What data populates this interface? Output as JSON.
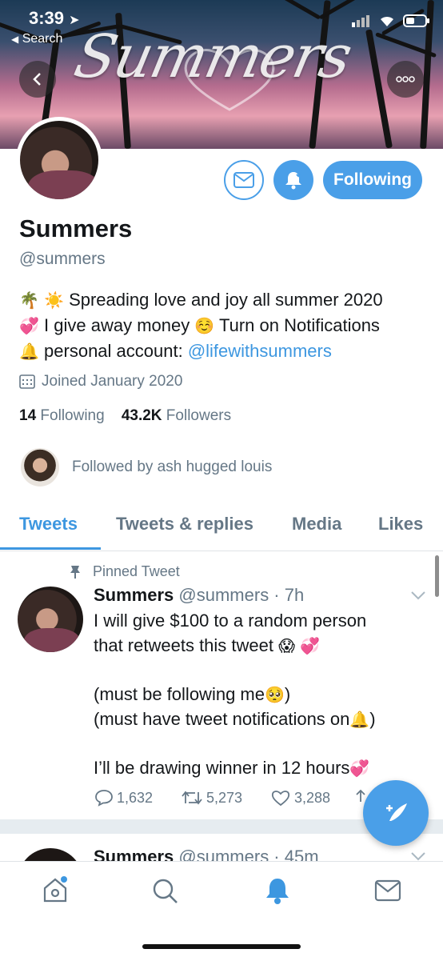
{
  "status_bar": {
    "time": "3:39",
    "back_app": "Search"
  },
  "header": {
    "banner_title": "Summers"
  },
  "profile": {
    "name": "Summers",
    "handle": "@summers",
    "follow_label": "Following",
    "bio": {
      "line1": "Spreading love and joy all summer 2020",
      "line2a": "I give away money",
      "line2b": "Turn on Notifications",
      "line3a": "personal account:",
      "line3_link": "@lifewithsummers"
    },
    "joined": "Joined January 2020",
    "following_count": "14",
    "following_label": "Following",
    "followers_count": "43.2K",
    "followers_label": "Followers",
    "followed_by": "Followed by ash hugged louis"
  },
  "tabs": [
    "Tweets",
    "Tweets & replies",
    "Media",
    "Likes"
  ],
  "pinned_tweet": {
    "pinned_label": "Pinned Tweet",
    "author": "Summers",
    "handle_time": "@summers · 7h",
    "lines": [
      "I will give $100 to a random person",
      "that retweets this tweet",
      "(must be following me",
      "(must have tweet notifications on",
      "I’ll be drawing winner in 12 hours"
    ],
    "replies": "1,632",
    "retweets": "5,273",
    "likes": "3,288"
  },
  "next_tweet": {
    "author": "Summers",
    "handle_time": "@summers · 45m"
  },
  "icons": {
    "emoji_palm": "🌴",
    "emoji_sun": "☀️",
    "emoji_hearts": "💞",
    "emoji_smile": "☺️",
    "emoji_bell": "🔔",
    "emoji_scream": "😱",
    "emoji_pleading": "🥺"
  },
  "colors": {
    "accent": "#4a9fe8",
    "link": "#3d97e0",
    "muted": "#657786"
  }
}
